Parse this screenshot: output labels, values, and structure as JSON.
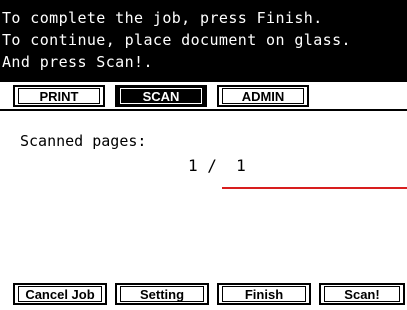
{
  "banner": {
    "line1": "To complete the job, press Finish.",
    "line2": "To continue, place document on glass.",
    "line3": "And press Scan!."
  },
  "tabs": [
    {
      "label": "PRINT",
      "active": false
    },
    {
      "label": "SCAN",
      "active": true
    },
    {
      "label": "ADMIN",
      "active": false
    }
  ],
  "main": {
    "scanned_label": "Scanned pages:",
    "page_count": "1 /  1"
  },
  "buttons": {
    "cancel_job": "Cancel Job",
    "setting": "Setting",
    "finish": "Finish",
    "scan": "Scan!"
  },
  "colors": {
    "banner_bg": "#000000",
    "accent_line": "#d81e1e"
  }
}
